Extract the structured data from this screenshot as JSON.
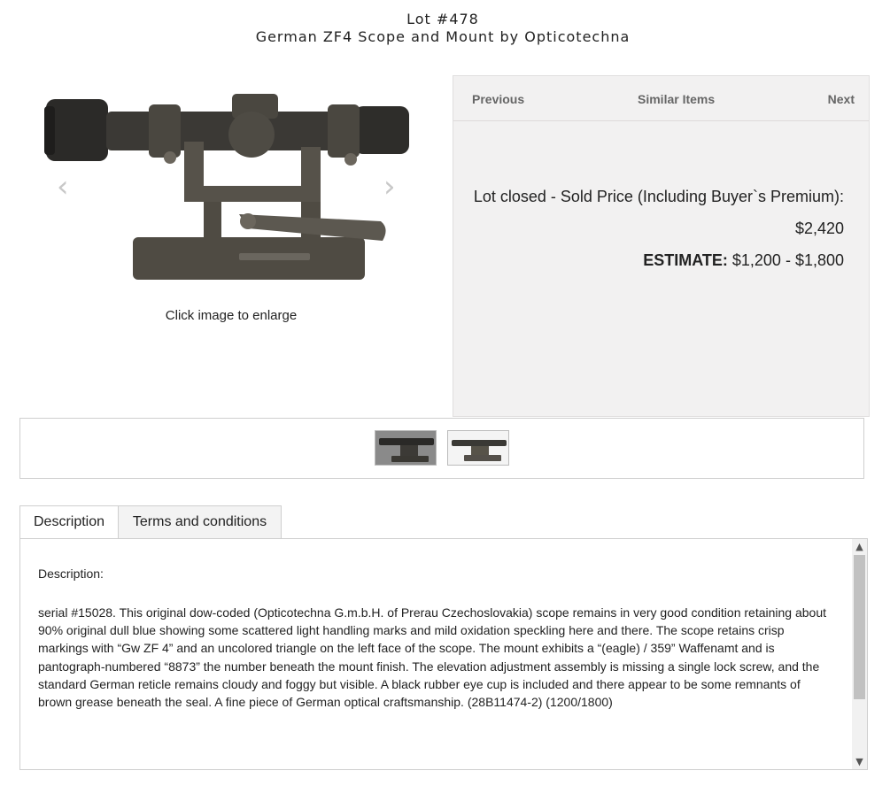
{
  "lot": {
    "number": "Lot #478",
    "title": "German ZF4 Scope and Mount by Opticotechna"
  },
  "image": {
    "caption": "Click image to enlarge",
    "prev_arrow": "‹",
    "next_arrow": "›"
  },
  "nav": {
    "previous": "Previous",
    "similar": "Similar Items",
    "next": "Next"
  },
  "pricing": {
    "status": "Lot closed - Sold Price (Including Buyer`s Premium):",
    "sold_price": "$2,420",
    "estimate_label": "ESTIMATE:",
    "estimate_range": "$1,200 - $1,800"
  },
  "tabs": [
    {
      "label": "Description",
      "active": true
    },
    {
      "label": "Terms and conditions",
      "active": false
    }
  ],
  "description": {
    "heading": "Description:",
    "body": "serial #15028. This original dow-coded (Opticotechna G.m.b.H. of Prerau Czechoslovakia) scope remains in very good condition retaining about 90% original dull blue showing some scattered light handling marks and mild oxidation speckling here and there. The scope retains crisp markings with “Gw ZF 4” and an uncolored triangle on the left face of the scope. The mount exhibits a “(eagle) / 359” Waffenamt and is pantograph-numbered “8873” the number beneath the mount finish. The elevation adjustment assembly is missing a single lock screw, and the standard German reticle remains cloudy and foggy but visible. A black rubber eye cup is included and there appear to be some remnants of brown grease beneath the seal. A fine piece of German optical craftsmanship. (28B11474-2) (1200/1800)"
  },
  "scrollbar": {
    "up": "▲",
    "down": "▼"
  },
  "colors": {
    "panel_bg": "#f2f1f1",
    "nav_text": "#666666",
    "scope_metal": "#4a4740"
  }
}
